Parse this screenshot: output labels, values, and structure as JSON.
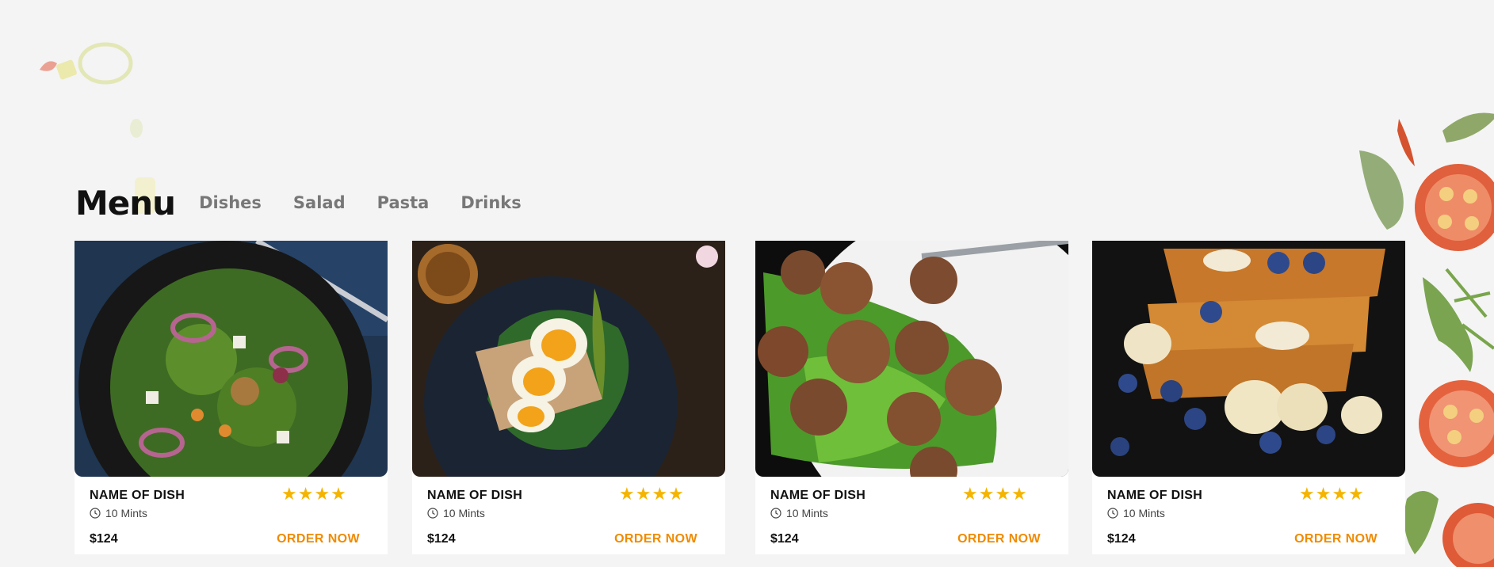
{
  "menu": {
    "title": "Menu",
    "tabs": [
      "Dishes",
      "Salad",
      "Pasta",
      "Drinks"
    ]
  },
  "cards": [
    {
      "name": "NAME OF DISH",
      "time": "10 Mints",
      "price": "$124",
      "order_label": "ORDER NOW",
      "rating": 4,
      "stars": "★★★★",
      "image": "salad-bowl-photo"
    },
    {
      "name": "NAME OF DISH",
      "time": "10 Mints",
      "price": "$124",
      "order_label": "ORDER NOW",
      "rating": 4,
      "stars": "★★★★",
      "image": "egg-avocado-toast-photo"
    },
    {
      "name": "NAME OF DISH",
      "time": "10 Mints",
      "price": "$124",
      "order_label": "ORDER NOW",
      "rating": 4,
      "stars": "★★★★",
      "image": "meatballs-arugula-photo"
    },
    {
      "name": "NAME OF DISH",
      "time": "10 Mints",
      "price": "$124",
      "order_label": "ORDER NOW",
      "rating": 4,
      "stars": "★★★★",
      "image": "french-toast-banana-blueberry-photo"
    }
  ],
  "colors": {
    "accent": "#f08a00",
    "star": "#f5b400",
    "background": "#f4f4f4"
  }
}
